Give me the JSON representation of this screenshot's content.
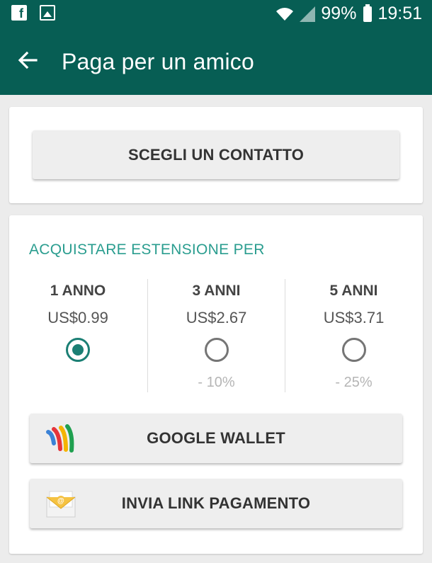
{
  "statusbar": {
    "battery": "99%",
    "time": "19:51",
    "icons": [
      "facebook-icon",
      "gallery-icon",
      "wifi-icon",
      "signal-icon",
      "battery-icon"
    ]
  },
  "appbar": {
    "title": "Paga per un amico",
    "back_icon": "arrow-left-icon"
  },
  "contact": {
    "button_label": "SCEGLI UN CONTATTO"
  },
  "purchase": {
    "section_title": "ACQUISTARE ESTENSIONE PER",
    "options": [
      {
        "label": "1 ANNO",
        "price": "US$0.99",
        "selected": true,
        "discount": ""
      },
      {
        "label": "3 ANNI",
        "price": "US$2.67",
        "selected": false,
        "discount": "- 10%"
      },
      {
        "label": "5 ANNI",
        "price": "US$3.71",
        "selected": false,
        "discount": "- 25%"
      }
    ],
    "google_wallet_label": "GOOGLE WALLET",
    "send_link_label": "INVIA LINK PAGAMENTO"
  },
  "colors": {
    "primary": "#075e54",
    "accent": "#2a9d8f",
    "radio_selected": "#1b7f74"
  }
}
